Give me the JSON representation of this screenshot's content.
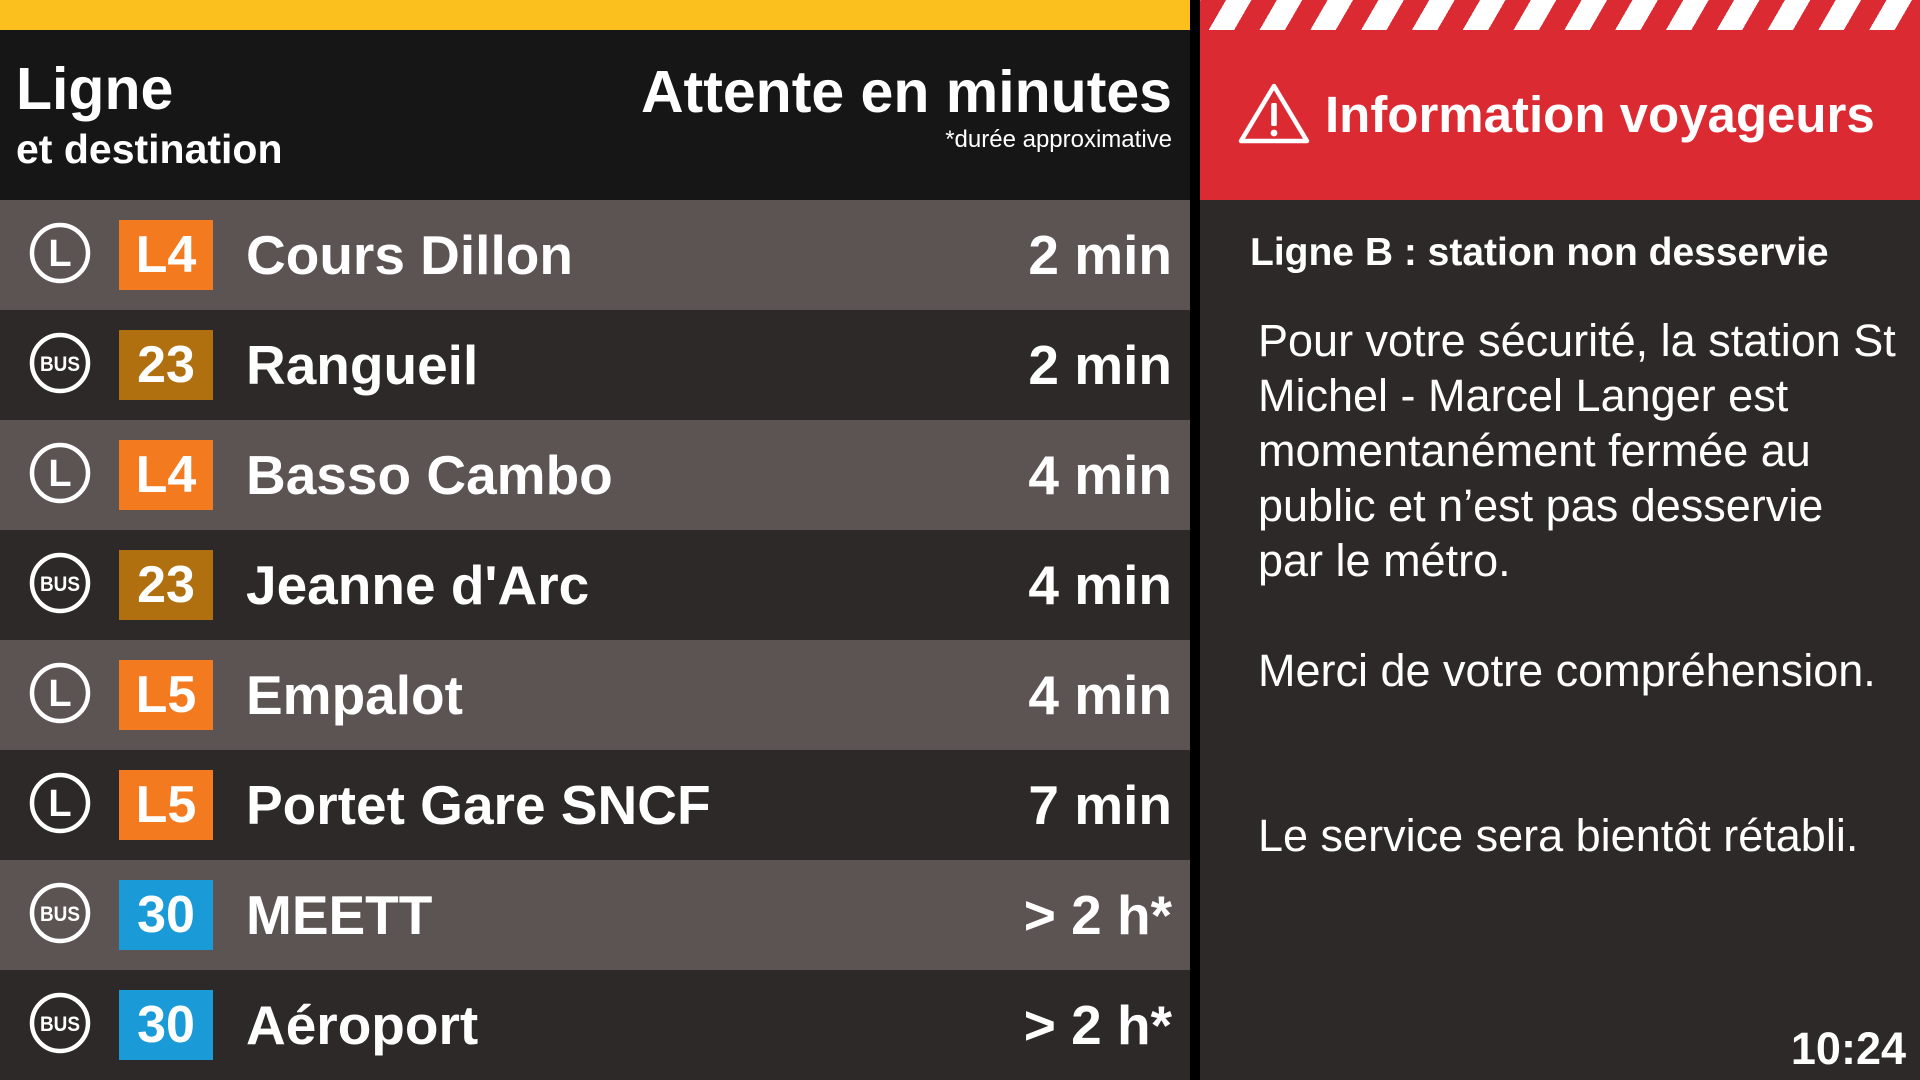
{
  "header": {
    "line_label": "Ligne",
    "destination_label": "et destination",
    "wait_label": "Attente en minutes",
    "wait_note": "*durée approximative"
  },
  "colors": {
    "yellow_bar": "#fbbf1e",
    "alert_red": "#dc2a32",
    "line_L4": "#f47a20",
    "line_L5": "#f47a20",
    "line_23": "#b0700f",
    "line_30": "#1a9bd7",
    "row_light": "#5c5452",
    "row_dark": "#2d2928"
  },
  "departures": [
    {
      "mode_icon": "L-circle-icon",
      "mode_text": "L",
      "line": "L4",
      "color": "#f47a20",
      "destination": "Cours Dillon",
      "wait": "2 min"
    },
    {
      "mode_icon": "bus-circle-icon",
      "mode_text": "BUS",
      "line": "23",
      "color": "#b0700f",
      "destination": "Rangueil",
      "wait": "2 min"
    },
    {
      "mode_icon": "L-circle-icon",
      "mode_text": "L",
      "line": "L4",
      "color": "#f47a20",
      "destination": "Basso Cambo",
      "wait": "4 min"
    },
    {
      "mode_icon": "bus-circle-icon",
      "mode_text": "BUS",
      "line": "23",
      "color": "#b0700f",
      "destination": "Jeanne d'Arc",
      "wait": "4 min"
    },
    {
      "mode_icon": "L-circle-icon",
      "mode_text": "L",
      "line": "L5",
      "color": "#f47a20",
      "destination": "Empalot",
      "wait": "4 min"
    },
    {
      "mode_icon": "L-circle-icon",
      "mode_text": "L",
      "line": "L5",
      "color": "#f47a20",
      "destination": "Portet Gare SNCF",
      "wait": "7 min"
    },
    {
      "mode_icon": "bus-circle-icon",
      "mode_text": "BUS",
      "line": "30",
      "color": "#1a9bd7",
      "destination": "MEETT",
      "wait": "> 2 h*"
    },
    {
      "mode_icon": "bus-circle-icon",
      "mode_text": "BUS",
      "line": "30",
      "color": "#1a9bd7",
      "destination": "Aéroport",
      "wait": "> 2 h*"
    }
  ],
  "info": {
    "icon": "warning-triangle-icon",
    "title": "Information voyageurs",
    "alert_title": "Ligne B : station non desservie",
    "message": "Pour votre sécurité, la station St Michel - Marcel Langer est momentanément fermée au public et n’est pas desservie par le métro.",
    "thanks": "Merci de votre compréhension.",
    "restore": "Le service sera bientôt rétabli."
  },
  "clock": "10:24"
}
